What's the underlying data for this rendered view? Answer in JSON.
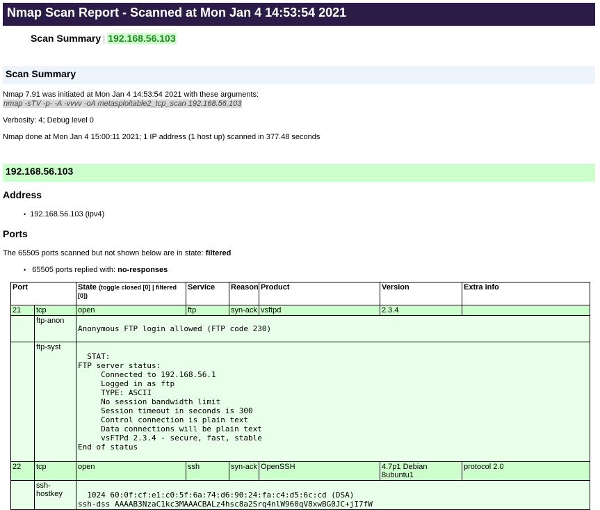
{
  "report_title": "Nmap Scan Report - Scanned at Mon Jan 4 14:53:54 2021",
  "nav": {
    "summary_link": "Scan Summary",
    "separator": "|",
    "host_link": "192.168.56.103"
  },
  "summary": {
    "heading": "Scan Summary",
    "initiated": "Nmap 7.91 was initiated at Mon Jan 4 14:53:54 2021 with these arguments:",
    "arguments": "nmap -sTV -p- -A -vvvv -oA metasploitable2_tcp_scan 192.168.56.103",
    "verbosity": "Verbosity: 4; Debug level 0",
    "done": "Nmap done at Mon Jan 4 15:00:11 2021; 1 IP address (1 host up) scanned in 377.48 seconds"
  },
  "host": {
    "heading": "192.168.56.103",
    "address_heading": "Address",
    "address_item": "192.168.56.103 (ipv4)",
    "ports_heading": "Ports",
    "not_shown_prefix": "The 65505 ports scanned but not shown below are in state:",
    "not_shown_state": "filtered",
    "replied_prefix": "65505 ports replied with:",
    "replied_reason": "no-responses"
  },
  "table": {
    "headers": {
      "port": "Port",
      "state": "State",
      "state_note": "(toggle closed [0] | filtered [0])",
      "service": "Service",
      "reason": "Reason",
      "product": "Product",
      "version": "Version",
      "extra": "Extra info"
    },
    "rows": [
      {
        "port": "21",
        "proto": "tcp",
        "state": "open",
        "service": "ftp",
        "reason": "syn-ack",
        "product": "vsftpd",
        "version": "2.3.4",
        "extra": ""
      },
      {
        "port": "22",
        "proto": "tcp",
        "state": "open",
        "service": "ssh",
        "reason": "syn-ack",
        "product": "OpenSSH",
        "version": "4.7p1 Debian 8ubuntu1",
        "extra": "protocol 2.0"
      }
    ],
    "scripts": [
      {
        "id": "ftp-anon",
        "output": "Anonymous FTP login allowed (FTP code 230)"
      },
      {
        "id": "ftp-syst",
        "output": "  STAT: \nFTP server status:\n     Connected to 192.168.56.1\n     Logged in as ftp\n     TYPE: ASCII\n     No session bandwidth limit\n     Session timeout in seconds is 300\n     Control connection is plain text\n     Data connections will be plain text\n     vsFTPd 2.3.4 - secure, fast, stable\nEnd of status"
      },
      {
        "id": "ssh-hostkey",
        "output": "  1024 60:0f:cf:e1:c0:5f:6a:74:d6:90:24:fa:c4:d5:6c:cd (DSA)\nssh-dss AAAAB3NzaC1kc3MAAACBALz4hsc8a2Srq4nlW960qV8xwBG0JC+jI7fW"
      }
    ]
  }
}
